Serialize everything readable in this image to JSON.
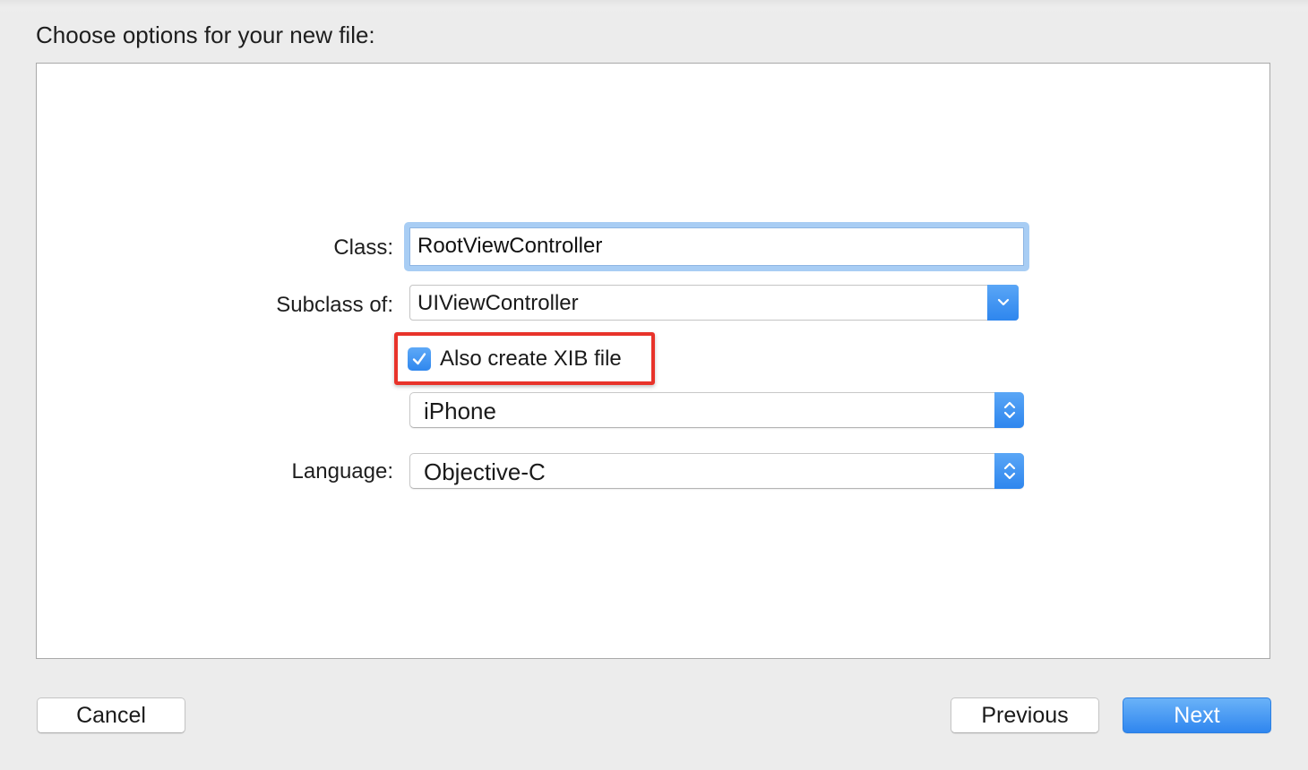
{
  "dialog": {
    "title": "Choose options for your new file:"
  },
  "form": {
    "class_label": "Class:",
    "class_value": "RootViewController",
    "subclass_label": "Subclass of:",
    "subclass_value": "UIViewController",
    "xib_checkbox_label": "Also create XIB file",
    "xib_checkbox_checked": true,
    "device_value": "iPhone",
    "language_label": "Language:",
    "language_value": "Objective-C"
  },
  "buttons": {
    "cancel_label": "Cancel",
    "previous_label": "Previous",
    "next_label": "Next"
  },
  "icons": {
    "combo_arrow": "chevron-down-icon",
    "popup_arrows": "chevron-up-down-icon",
    "checkbox": "checkmark-icon"
  },
  "colors": {
    "accent_blue": "#2f86ef",
    "focus_ring": "#a8cdf4",
    "highlight_red": "#e8332a"
  }
}
